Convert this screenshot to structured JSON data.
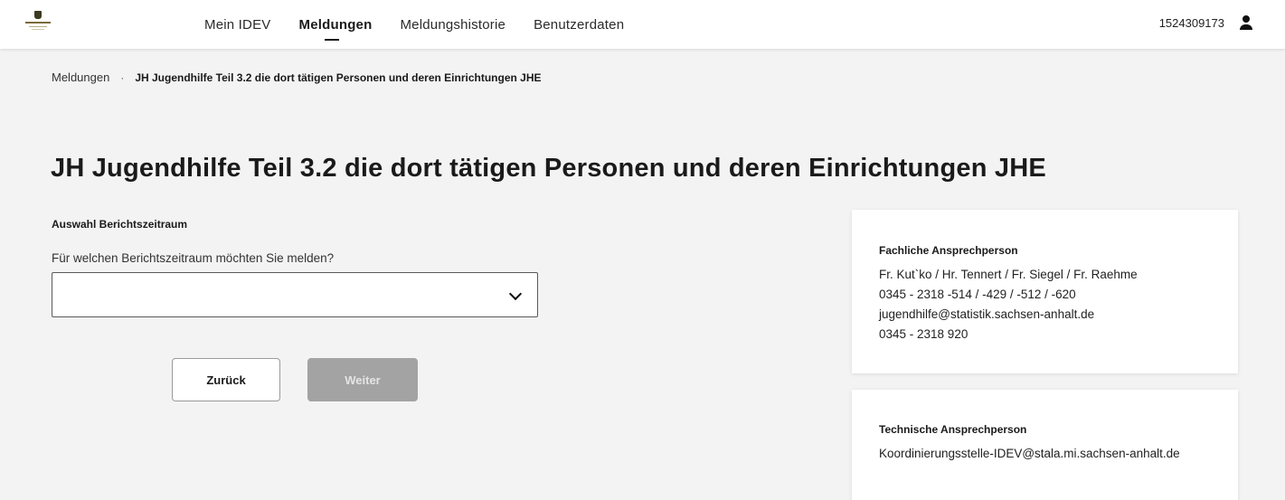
{
  "header": {
    "nav": [
      {
        "label": "Mein IDEV",
        "active": false
      },
      {
        "label": "Meldungen",
        "active": true
      },
      {
        "label": "Meldungshistorie",
        "active": false
      },
      {
        "label": "Benutzerdaten",
        "active": false
      }
    ],
    "user_id": "1524309173",
    "user_icon": "user-icon",
    "logo_icon": "sachsen-anhalt-logo"
  },
  "breadcrumb": {
    "root": "Meldungen",
    "separator": "·",
    "current": "JH Jugendhilfe Teil 3.2 die dort tätigen Personen und deren Einrichtungen JHE"
  },
  "main": {
    "title": "JH Jugendhilfe Teil 3.2 die dort tätigen Personen und deren Einrichtungen JHE",
    "section_label": "Auswahl Berichtszeitraum",
    "question": "Für welchen Berichtszeitraum möchten Sie melden?",
    "select_value": "",
    "back_label": "Zurück",
    "next_label": "Weiter"
  },
  "contacts": {
    "fachlich": {
      "title": "Fachliche Ansprechperson",
      "lines": [
        "Fr. Kut`ko / Hr. Tennert / Fr. Siegel / Fr. Raehme",
        "0345 - 2318 -514 / -429 / -512 / -620",
        "jugendhilfe@statistik.sachsen-anhalt.de",
        "0345 - 2318 920"
      ]
    },
    "technisch": {
      "title": "Technische Ansprechperson",
      "lines": [
        "Koordinierungsstelle-IDEV@stala.mi.sachsen-anhalt.de"
      ]
    }
  },
  "colors": {
    "background": "#f3f3f3",
    "button_disabled": "#a3a3a3"
  }
}
